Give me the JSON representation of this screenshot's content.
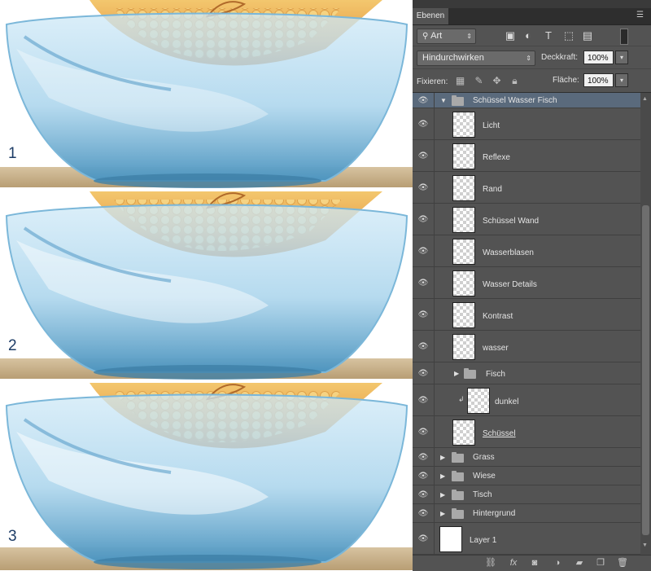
{
  "artwork": {
    "step_numbers": [
      "1",
      "2",
      "3"
    ]
  },
  "panel": {
    "tab_label": "Ebenen",
    "menu_icon": "panel-menu-icon",
    "filter_kind": "Art",
    "blend_mode": "Hindurchwirken",
    "opacity_label": "Deckkraft:",
    "opacity_value": "100%",
    "lock_label": "Fixieren:",
    "fill_label": "Fläche:",
    "fill_value": "100%"
  },
  "layers": [
    {
      "name": "Schüssel Wasser Fisch",
      "type": "group-open",
      "selected": true
    },
    {
      "name": "Licht",
      "type": "layer"
    },
    {
      "name": "Reflexe",
      "type": "layer"
    },
    {
      "name": "Rand",
      "type": "layer"
    },
    {
      "name": "Schüssel Wand",
      "type": "layer"
    },
    {
      "name": "Wasserblasen",
      "type": "layer"
    },
    {
      "name": "Wasser Details",
      "type": "layer"
    },
    {
      "name": "Kontrast",
      "type": "layer"
    },
    {
      "name": "wasser",
      "type": "layer"
    },
    {
      "name": "Fisch",
      "type": "group-closed"
    },
    {
      "name": "dunkel",
      "type": "clipped-layer"
    },
    {
      "name": "Schüssel",
      "type": "layer"
    },
    {
      "name": "Grass",
      "type": "group-closed"
    },
    {
      "name": "Wiese",
      "type": "group-closed"
    },
    {
      "name": "Tisch",
      "type": "group-closed"
    },
    {
      "name": "Hintergrund",
      "type": "group-closed"
    },
    {
      "name": "Layer 1",
      "type": "fill-layer"
    }
  ]
}
